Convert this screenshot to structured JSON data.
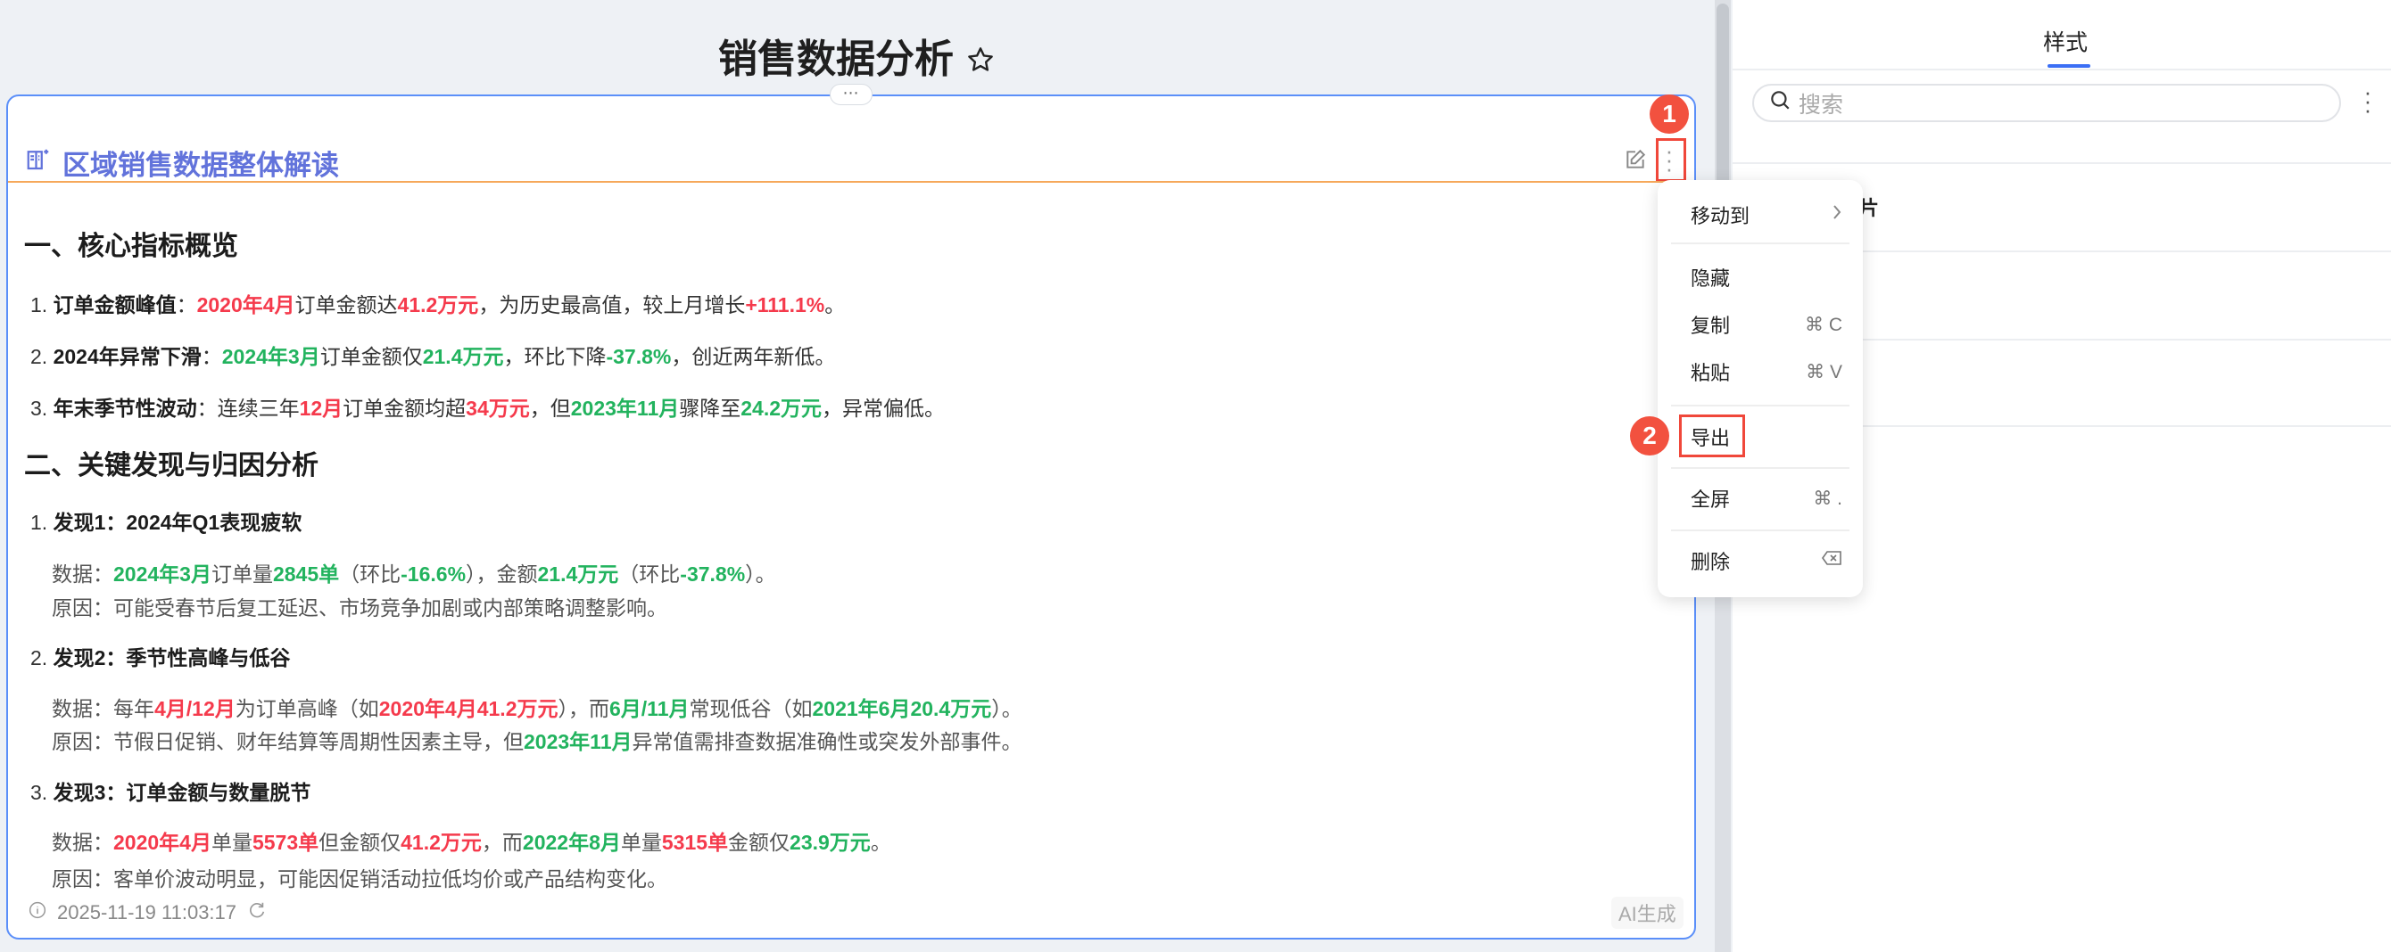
{
  "page": {
    "title": "销售数据分析"
  },
  "card": {
    "title": "区域销售数据整体解读",
    "footer_time": "2025-11-19 11:03:17",
    "ai_badge": "AI生成",
    "lines": [
      {
        "type": "h",
        "segs": [
          {
            "t": "一、核心指标概览",
            "c": "n"
          }
        ]
      },
      {
        "type": "li",
        "segs": [
          {
            "t": "1. ",
            "c": "n"
          },
          {
            "t": "订单金额峰值",
            "c": "b"
          },
          {
            "t": "：",
            "c": "n"
          },
          {
            "t": "2020年4月",
            "c": "r"
          },
          {
            "t": "订单金额达",
            "c": "n"
          },
          {
            "t": "41.2万元",
            "c": "r"
          },
          {
            "t": "，为历史最高值，较上月增长",
            "c": "n"
          },
          {
            "t": "+111.1%",
            "c": "r"
          },
          {
            "t": "。",
            "c": "n"
          }
        ]
      },
      {
        "type": "li",
        "segs": [
          {
            "t": "2. ",
            "c": "n"
          },
          {
            "t": "2024年异常下滑",
            "c": "b"
          },
          {
            "t": "：",
            "c": "n"
          },
          {
            "t": "2024年3月",
            "c": "g"
          },
          {
            "t": "订单金额仅",
            "c": "n"
          },
          {
            "t": "21.4万元",
            "c": "g"
          },
          {
            "t": "，环比下降",
            "c": "n"
          },
          {
            "t": "-37.8%",
            "c": "g"
          },
          {
            "t": "，创近两年新低。",
            "c": "n"
          }
        ]
      },
      {
        "type": "li",
        "segs": [
          {
            "t": "3. ",
            "c": "n"
          },
          {
            "t": "年末季节性波动",
            "c": "b"
          },
          {
            "t": "：连续三年",
            "c": "n"
          },
          {
            "t": "12月",
            "c": "r"
          },
          {
            "t": "订单金额均超",
            "c": "n"
          },
          {
            "t": "34万元",
            "c": "r"
          },
          {
            "t": "，但",
            "c": "n"
          },
          {
            "t": "2023年11月",
            "c": "g"
          },
          {
            "t": "骤降至",
            "c": "n"
          },
          {
            "t": "24.2万元",
            "c": "g"
          },
          {
            "t": "，异常偏低。",
            "c": "n"
          }
        ]
      },
      {
        "type": "h",
        "segs": [
          {
            "t": "二、关键发现与归因分析",
            "c": "n"
          }
        ]
      },
      {
        "type": "li",
        "segs": [
          {
            "t": "1. ",
            "c": "n"
          },
          {
            "t": "发现1：2024年Q1表现疲软",
            "c": "b"
          }
        ]
      },
      {
        "type": "dl",
        "segs": [
          {
            "t": "数据：",
            "c": "n"
          },
          {
            "t": "2024年3月",
            "c": "g"
          },
          {
            "t": "订单量",
            "c": "n"
          },
          {
            "t": "2845单",
            "c": "g"
          },
          {
            "t": "（环比",
            "c": "n"
          },
          {
            "t": "-16.6%",
            "c": "g"
          },
          {
            "t": "），金额",
            "c": "n"
          },
          {
            "t": "21.4万元",
            "c": "g"
          },
          {
            "t": "（环比",
            "c": "n"
          },
          {
            "t": "-37.8%",
            "c": "g"
          },
          {
            "t": "）。",
            "c": "n"
          }
        ]
      },
      {
        "type": "dl",
        "segs": [
          {
            "t": "原因：可能受春节后复工延迟、市场竞争加剧或内部策略调整影响。",
            "c": "n"
          }
        ]
      },
      {
        "type": "li",
        "segs": [
          {
            "t": "2. ",
            "c": "n"
          },
          {
            "t": "发现2：季节性高峰与低谷",
            "c": "b"
          }
        ]
      },
      {
        "type": "dl",
        "segs": [
          {
            "t": "数据：每年",
            "c": "n"
          },
          {
            "t": "4月/12月",
            "c": "r"
          },
          {
            "t": "为订单高峰（如",
            "c": "n"
          },
          {
            "t": "2020年4月41.2万元",
            "c": "r"
          },
          {
            "t": "），而",
            "c": "n"
          },
          {
            "t": "6月/11月",
            "c": "g"
          },
          {
            "t": "常现低谷（如",
            "c": "n"
          },
          {
            "t": "2021年6月20.4万元",
            "c": "g"
          },
          {
            "t": "）。",
            "c": "n"
          }
        ]
      },
      {
        "type": "dl",
        "segs": [
          {
            "t": "原因：节假日促销、财年结算等周期性因素主导，但",
            "c": "n"
          },
          {
            "t": "2023年11月",
            "c": "g"
          },
          {
            "t": "异常值需排查数据准确性或突发外部事件。",
            "c": "n"
          }
        ]
      },
      {
        "type": "li",
        "segs": [
          {
            "t": "3. ",
            "c": "n"
          },
          {
            "t": "发现3：订单金额与数量脱节",
            "c": "b"
          }
        ]
      },
      {
        "type": "dl",
        "segs": [
          {
            "t": "数据：",
            "c": "n"
          },
          {
            "t": "2020年4月",
            "c": "r"
          },
          {
            "t": "单量",
            "c": "n"
          },
          {
            "t": "5573单",
            "c": "r"
          },
          {
            "t": "但金额仅",
            "c": "n"
          },
          {
            "t": "41.2万元",
            "c": "r"
          },
          {
            "t": "，而",
            "c": "n"
          },
          {
            "t": "2022年8月",
            "c": "g"
          },
          {
            "t": "单量",
            "c": "n"
          },
          {
            "t": "5315单",
            "c": "r"
          },
          {
            "t": "金额仅",
            "c": "n"
          },
          {
            "t": "23.9万元",
            "c": "g"
          },
          {
            "t": "。",
            "c": "n"
          }
        ]
      },
      {
        "type": "dl",
        "segs": [
          {
            "t": "原因：客单价波动明显，可能因促销活动拉低均价或产品结构变化。",
            "c": "n"
          }
        ]
      }
    ]
  },
  "menu": {
    "items": [
      {
        "label": "移动到",
        "shortcut": ""
      },
      {
        "label": "隐藏",
        "shortcut": ""
      },
      {
        "label": "复制",
        "shortcut": "⌘ C"
      },
      {
        "label": "粘贴",
        "shortcut": "⌘ V"
      },
      {
        "label": "导出",
        "shortcut": ""
      },
      {
        "label": "全屏",
        "shortcut": "⌘ ."
      },
      {
        "label": "删除",
        "shortcut": ""
      }
    ]
  },
  "annotations": {
    "step1": "1",
    "step2": "2"
  },
  "panel": {
    "tab": "样式",
    "search_placeholder": "搜索",
    "section": "标题与卡片"
  },
  "colors": {
    "accent": "#5b8ff9",
    "red": "#f53a4c",
    "green": "#22b35e",
    "title": "#6273db"
  }
}
